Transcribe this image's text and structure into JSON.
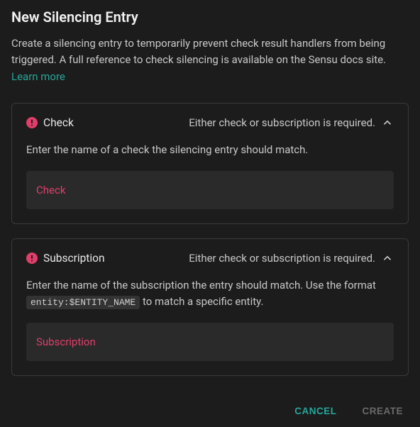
{
  "title": "New Silencing Entry",
  "description": "Create a silencing entry to temporarily prevent check result handlers from being triggered. A full reference to check silencing is available on the Sensu docs site.",
  "learn_more": "Learn more",
  "panels": {
    "check": {
      "title": "Check",
      "required_msg": "Either check or subscription is required.",
      "hint": "Enter the name of a check the silencing entry should match.",
      "field_label": "Check"
    },
    "subscription": {
      "title": "Subscription",
      "required_msg": "Either check or subscription is required.",
      "hint_pre": "Enter the name of the subscription the entry should match. Use the format ",
      "hint_code": "entity:$ENTITY_NAME",
      "hint_post": " to match a specific entity.",
      "field_label": "Subscription"
    }
  },
  "buttons": {
    "cancel": "CANCEL",
    "create": "CREATE"
  },
  "colors": {
    "accent": "#26a69a",
    "error": "#e03e6a"
  }
}
